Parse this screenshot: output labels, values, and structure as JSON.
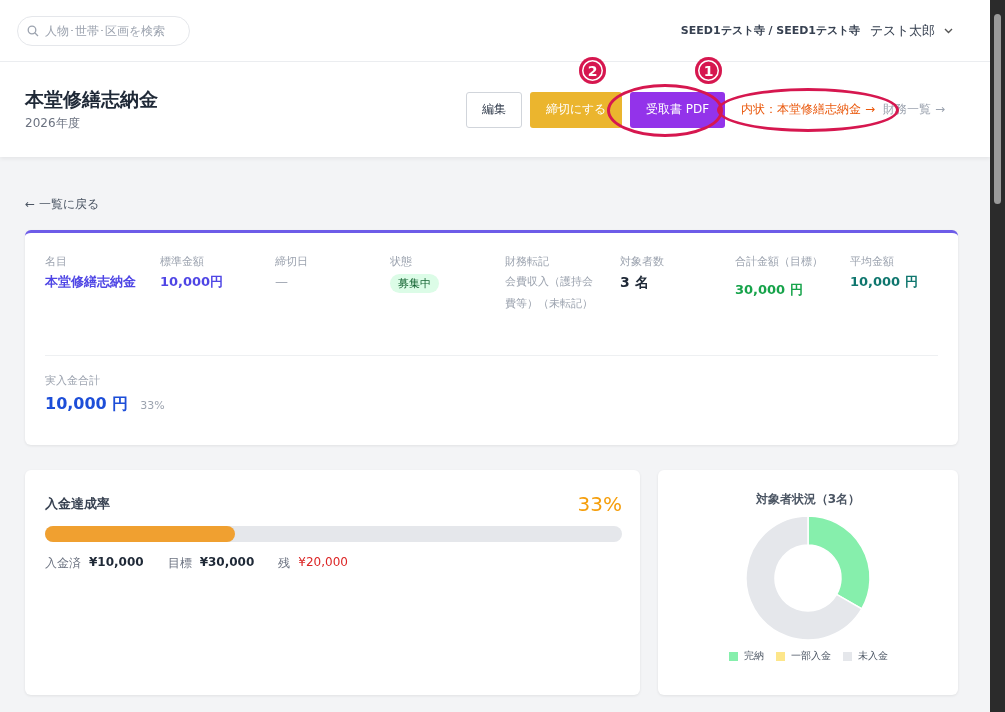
{
  "header": {
    "search": {
      "placeholder": "人物･世帯･区画を検索"
    },
    "org": "SEED1テスト寺 / SEED1テスト寺",
    "user": "テスト太郎"
  },
  "title_bar": {
    "title": "本堂修繕志納金",
    "subtitle": "2026年度",
    "buttons": [
      {
        "label": "編集",
        "kind": "outline"
      },
      {
        "label": "締切にする",
        "kind": "warning"
      },
      {
        "label": "受取書 PDF",
        "kind": "primary"
      }
    ],
    "links": [
      {
        "label": "内状：本堂修繕志納金 →",
        "kind": "accent"
      },
      {
        "label": "財務一覧 →",
        "kind": "muted"
      }
    ]
  },
  "back_link": "← 一覧に戻る",
  "summary": {
    "fields": [
      {
        "label": "名目",
        "value": "本堂修繕志納金",
        "kind": "purple"
      },
      {
        "label": "標準金額",
        "value": "10,000円",
        "kind": "purple"
      },
      {
        "label": "締切日",
        "value": "—",
        "kind": "plain"
      },
      {
        "label": "状態",
        "value": "募集中",
        "kind": "badge"
      },
      {
        "label": "財務転記",
        "value": "会費収入（護持会費等）（未転記）",
        "kind": "small"
      },
      {
        "label": "対象者数",
        "value": "3 名",
        "kind": "dark"
      },
      {
        "label": "合計金額（目標）",
        "value": "30,000 円",
        "kind": "green"
      },
      {
        "label": "平均金額",
        "value": "10,000 円",
        "kind": "teal"
      }
    ],
    "received": {
      "label": "実入金合計",
      "value": "10,000 円",
      "percent": "33%"
    }
  },
  "progress": {
    "title": "入金達成率",
    "percent": "33%",
    "level": 0.33,
    "stats": [
      {
        "label": "入金済",
        "value": "¥10,000",
        "kind": "dark"
      },
      {
        "label": "目標",
        "value": "¥30,000",
        "kind": "dark"
      },
      {
        "label": "残",
        "value": "¥20,000",
        "kind": "red"
      }
    ]
  },
  "status_chart": {
    "chart_data": {
      "type": "donut",
      "title": "対象者状況（3名）",
      "categories": [
        "完納",
        "一部入金",
        "未入金"
      ],
      "values": [
        33.3,
        0,
        66.7
      ],
      "colors": [
        "#86efac",
        "#fde68a",
        "#e5e7eb"
      ]
    }
  },
  "annotations": [
    {
      "label": "2"
    },
    {
      "label": "1"
    }
  ]
}
